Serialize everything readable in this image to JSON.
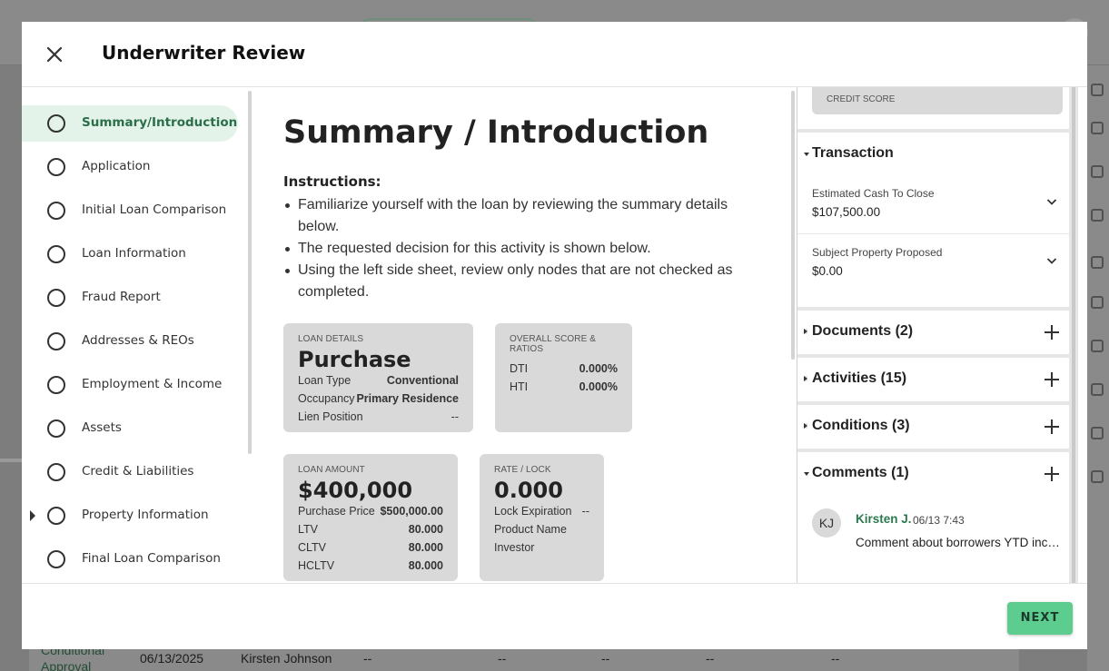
{
  "background": {
    "row": {
      "status": "Conditional Approval",
      "date": "06/13/2025",
      "user": "Kirsten Johnson",
      "dash": "--"
    }
  },
  "modal": {
    "title": "Underwriter Review",
    "close_icon": "close-icon"
  },
  "nav": {
    "items": [
      {
        "label": "Summary/Introduction",
        "active": true
      },
      {
        "label": "Application"
      },
      {
        "label": "Initial Loan Comparison"
      },
      {
        "label": "Loan Information"
      },
      {
        "label": "Fraud Report"
      },
      {
        "label": "Addresses & REOs"
      },
      {
        "label": "Employment & Income"
      },
      {
        "label": "Assets"
      },
      {
        "label": "Credit & Liabilities"
      },
      {
        "label": "Property Information",
        "expandable": true
      },
      {
        "label": "Final Loan Comparison"
      }
    ]
  },
  "main": {
    "heading": "Summary / Introduction",
    "instructions_title": "Instructions:",
    "instructions": [
      "Familiarize yourself with the loan by reviewing the summary details below.",
      "The requested decision for this activity is shown below.",
      "Using the left side sheet, review only nodes that are not checked as completed."
    ],
    "loan_details": {
      "caption": "LOAN DETAILS",
      "value": "Purchase",
      "rows": [
        {
          "k": "Loan Type",
          "v": "Conventional"
        },
        {
          "k": "Occupancy",
          "v": "Primary Residence"
        },
        {
          "k": "Lien Position",
          "v": "--"
        }
      ]
    },
    "score": {
      "caption": "OVERALL SCORE & RATIOS",
      "rows": [
        {
          "k": "DTI",
          "v": "0.000%"
        },
        {
          "k": "HTI",
          "v": "0.000%"
        }
      ]
    },
    "loan_amount": {
      "caption": "LOAN AMOUNT",
      "value": "$400,000",
      "rows": [
        {
          "k": "Purchase Price",
          "v": "$500,000.00"
        },
        {
          "k": "LTV",
          "v": "80.000"
        },
        {
          "k": "CLTV",
          "v": "80.000"
        },
        {
          "k": "HCLTV",
          "v": "80.000"
        }
      ]
    },
    "rate_lock": {
      "caption": "RATE / LOCK",
      "value": "0.000",
      "rows": [
        {
          "k": "Lock Expiration",
          "v": "--"
        },
        {
          "k": "Product Name",
          "v": ""
        },
        {
          "k": "Investor",
          "v": ""
        }
      ]
    }
  },
  "right": {
    "credit_score_label": "CREDIT SCORE",
    "transaction": {
      "title": "Transaction",
      "fields": [
        {
          "label": "Estimated Cash To Close",
          "value": "$107,500.00"
        },
        {
          "label": "Subject Property Proposed",
          "value": "$0.00"
        }
      ]
    },
    "documents": "Documents (2)",
    "activities": "Activities (15)",
    "conditions": "Conditions (3)",
    "comments": {
      "title": "Comments (1)",
      "initials": "KJ",
      "author": "Kirsten J.",
      "time": "06/13 7:43",
      "text": "Comment about borrowers YTD income"
    }
  },
  "footer": {
    "next_label": "NEXT"
  },
  "colors": {
    "accent": "#5ccc8f",
    "active_nav_bg": "#e3f3ea",
    "active_nav_text": "#2a6f48",
    "card_bg": "#d9d9d9"
  }
}
